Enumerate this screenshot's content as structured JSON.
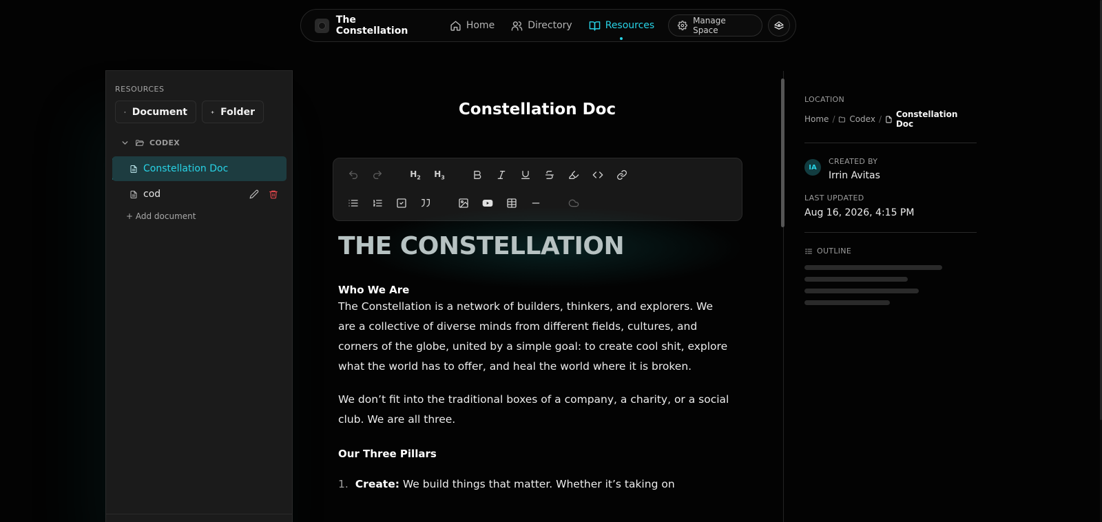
{
  "nav": {
    "brand": "The Constellation",
    "home": "Home",
    "directory": "Directory",
    "resources": "Resources",
    "manage": "Manage Space",
    "accent": "#28d3e6"
  },
  "sidebar": {
    "title": "RESOURCES",
    "new_document": "Document",
    "new_folder": "Folder",
    "folder": "CODEX",
    "items": [
      {
        "label": "Constellation Doc",
        "active": true
      },
      {
        "label": "cod",
        "active": false
      }
    ],
    "add_document": "+ Add document"
  },
  "editor": {
    "title": "Constellation Doc",
    "toolbar": {
      "row1": [
        "undo-icon",
        "redo-icon",
        "heading-2",
        "heading-3",
        "bold-icon",
        "italic-icon",
        "underline-icon",
        "strikethrough-icon",
        "highlight-icon",
        "code-icon",
        "link-icon"
      ],
      "row2": [
        "bullet-list-icon",
        "ordered-list-icon",
        "task-list-icon",
        "quote-icon",
        "image-icon",
        "youtube-icon",
        "table-icon",
        "horizontal-rule-icon",
        "cloud-icon"
      ],
      "h2": "H",
      "h2_sub": "2",
      "h3": "H",
      "h3_sub": "3"
    },
    "heading": "THE CONSTELLATION",
    "section1_title": "Who We Are",
    "section1_body": "The Constellation is a network of builders, thinkers, and explorers. We are a collective of diverse minds from different fields, cultures, and corners of the globe, united by a simple goal: to create cool shit, explore what the world has to offer, and heal the world where it is broken.",
    "section1_body2": "We don’t fit into the traditional boxes of a company, a charity, or a social club. We are all three.",
    "section2_title": "Our Three Pillars",
    "list": [
      {
        "num": "1.",
        "bold": "Create:",
        "text": "We build things that matter. Whether it’s taking on"
      }
    ]
  },
  "details": {
    "location_label": "LOCATION",
    "crumb_home": "Home",
    "crumb_folder": "Codex",
    "crumb_doc": "Constellation Doc",
    "created_label": "CREATED BY",
    "creator_initials": "IA",
    "creator_name": "Irrin Avitas",
    "updated_label": "LAST UPDATED",
    "updated_value": "Aug 16, 2026, 4:15 PM",
    "outline_label": "OUTLINE"
  }
}
